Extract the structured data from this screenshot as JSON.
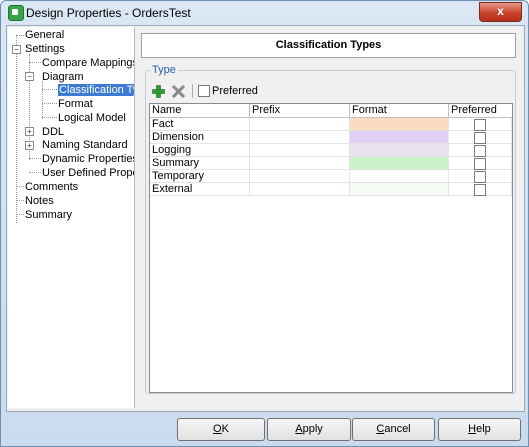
{
  "window": {
    "title": "Design Properties - OrdersTest",
    "close_label": "x"
  },
  "tree": {
    "items": [
      {
        "label": "General"
      },
      {
        "label": "Settings"
      },
      {
        "label": "Compare Mappings"
      },
      {
        "label": "Diagram"
      },
      {
        "label": "Classification Types"
      },
      {
        "label": "Format"
      },
      {
        "label": "Logical Model"
      },
      {
        "label": "DDL"
      },
      {
        "label": "Naming Standard"
      },
      {
        "label": "Dynamic Properties"
      },
      {
        "label": "User Defined Properties"
      },
      {
        "label": "Comments"
      },
      {
        "label": "Notes"
      },
      {
        "label": "Summary"
      }
    ],
    "expander_open": "−",
    "expander_closed": "+"
  },
  "panel": {
    "header": "Classification Types",
    "group_title": "Type",
    "preferred_filter_label": "Preferred"
  },
  "grid": {
    "columns": [
      "Name",
      "Prefix",
      "Format",
      "Preferred"
    ],
    "rows": [
      {
        "name": "Fact",
        "prefix": "",
        "format_color": "#fbdcc1",
        "preferred": false
      },
      {
        "name": "Dimension",
        "prefix": "",
        "format_color": "#e2cff5",
        "preferred": false
      },
      {
        "name": "Logging",
        "prefix": "",
        "format_color": "#e8e3ef",
        "preferred": false
      },
      {
        "name": "Summary",
        "prefix": "",
        "format_color": "#cbf2c9",
        "preferred": false
      },
      {
        "name": "Temporary",
        "prefix": "",
        "format_color": "#ffffff",
        "preferred": false
      },
      {
        "name": "External",
        "prefix": "",
        "format_color": "#f3fbf3",
        "preferred": false
      }
    ]
  },
  "buttons": {
    "ok": {
      "mnemonic": "O",
      "rest": "K"
    },
    "apply": {
      "mnemonic": "A",
      "rest": "pply"
    },
    "cancel": {
      "mnemonic": "C",
      "rest": "ancel"
    },
    "help": {
      "mnemonic": "H",
      "rest": "elp"
    }
  },
  "colors": {
    "accent": "#3d7bd2",
    "group_title": "#2a5fa8",
    "add_icon": "#2f9a34",
    "delete_icon": "#8a8a8a"
  }
}
